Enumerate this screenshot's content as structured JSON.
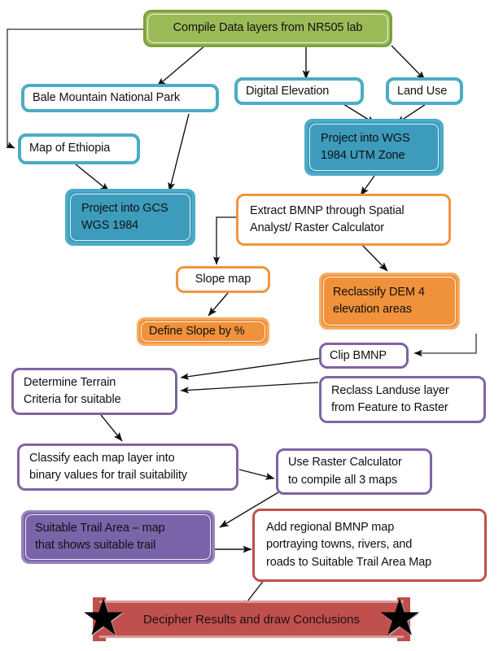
{
  "diagram": {
    "title": "NR505 GIS Trail Suitability Workflow",
    "colors": {
      "green": "#9BBB59",
      "teal": "#4BACC6",
      "teal_fill": "#3D9CBC",
      "orange": "#F0953F",
      "orange_fill": "#F0913B",
      "purple": "#8064A2",
      "purple_fill": "#7A63A8",
      "red": "#C0504D"
    },
    "nodes": [
      {
        "id": "compile",
        "lines": [
          "Compile Data layers from NR505 lab"
        ]
      },
      {
        "id": "bale",
        "lines": [
          "Bale Mountain National Park"
        ]
      },
      {
        "id": "dem",
        "lines": [
          "Digital Elevation"
        ]
      },
      {
        "id": "landuse",
        "lines": [
          "Land Use"
        ]
      },
      {
        "id": "ethiopia",
        "lines": [
          "Map of Ethiopia"
        ]
      },
      {
        "id": "wgs_utm",
        "lines": [
          "Project into WGS",
          "1984 UTM Zone"
        ]
      },
      {
        "id": "gcs",
        "lines": [
          "Project into GCS",
          "WGS 1984"
        ]
      },
      {
        "id": "extract",
        "lines": [
          "Extract BMNP through Spatial",
          "Analyst/ Raster Calculator"
        ]
      },
      {
        "id": "slope_map",
        "lines": [
          "Slope map"
        ]
      },
      {
        "id": "reclass_dem",
        "lines": [
          "Reclassify DEM 4",
          "elevation areas"
        ]
      },
      {
        "id": "define_slope",
        "lines": [
          "Define Slope by %"
        ]
      },
      {
        "id": "clip_bmnp",
        "lines": [
          "Clip BMNP"
        ]
      },
      {
        "id": "terrain",
        "lines": [
          "Determine Terrain",
          "Criteria for suitable"
        ]
      },
      {
        "id": "reclass_land",
        "lines": [
          "Reclass Landuse layer",
          "from Feature to Raster"
        ]
      },
      {
        "id": "classify",
        "lines": [
          "Classify each map layer into",
          "binary values for trail suitability"
        ]
      },
      {
        "id": "raster_calc",
        "lines": [
          "Use Raster Calculator",
          "to compile all 3 maps"
        ]
      },
      {
        "id": "suitable_area",
        "lines": [
          "Suitable Trail Area – map",
          "that shows suitable trail"
        ]
      },
      {
        "id": "regional",
        "lines": [
          "Add regional BMNP map",
          "portraying towns, rivers, and",
          "roads to Suitable Trail Area Map"
        ]
      },
      {
        "id": "decipher",
        "lines": [
          "Decipher Results and draw Conclusions"
        ]
      }
    ],
    "star_glyph": "★",
    "edges": [
      {
        "from": "compile",
        "to": "bale"
      },
      {
        "from": "compile",
        "to": "dem"
      },
      {
        "from": "compile",
        "to": "landuse"
      },
      {
        "from": "compile",
        "to": "ethiopia"
      },
      {
        "from": "bale",
        "to": "gcs"
      },
      {
        "from": "ethiopia",
        "to": "gcs"
      },
      {
        "from": "dem",
        "to": "wgs_utm"
      },
      {
        "from": "landuse",
        "to": "wgs_utm"
      },
      {
        "from": "wgs_utm",
        "to": "extract"
      },
      {
        "from": "extract",
        "to": "slope_map"
      },
      {
        "from": "extract",
        "to": "reclass_dem"
      },
      {
        "from": "slope_map",
        "to": "define_slope"
      },
      {
        "from": "reclass_dem",
        "to": "clip_bmnp"
      },
      {
        "from": "clip_bmnp",
        "to": "terrain"
      },
      {
        "from": "reclass_land",
        "to": "terrain"
      },
      {
        "from": "terrain",
        "to": "classify"
      },
      {
        "from": "classify",
        "to": "raster_calc"
      },
      {
        "from": "raster_calc",
        "to": "suitable_area"
      },
      {
        "from": "suitable_area",
        "to": "regional"
      },
      {
        "from": "regional",
        "to": "decipher"
      }
    ]
  }
}
